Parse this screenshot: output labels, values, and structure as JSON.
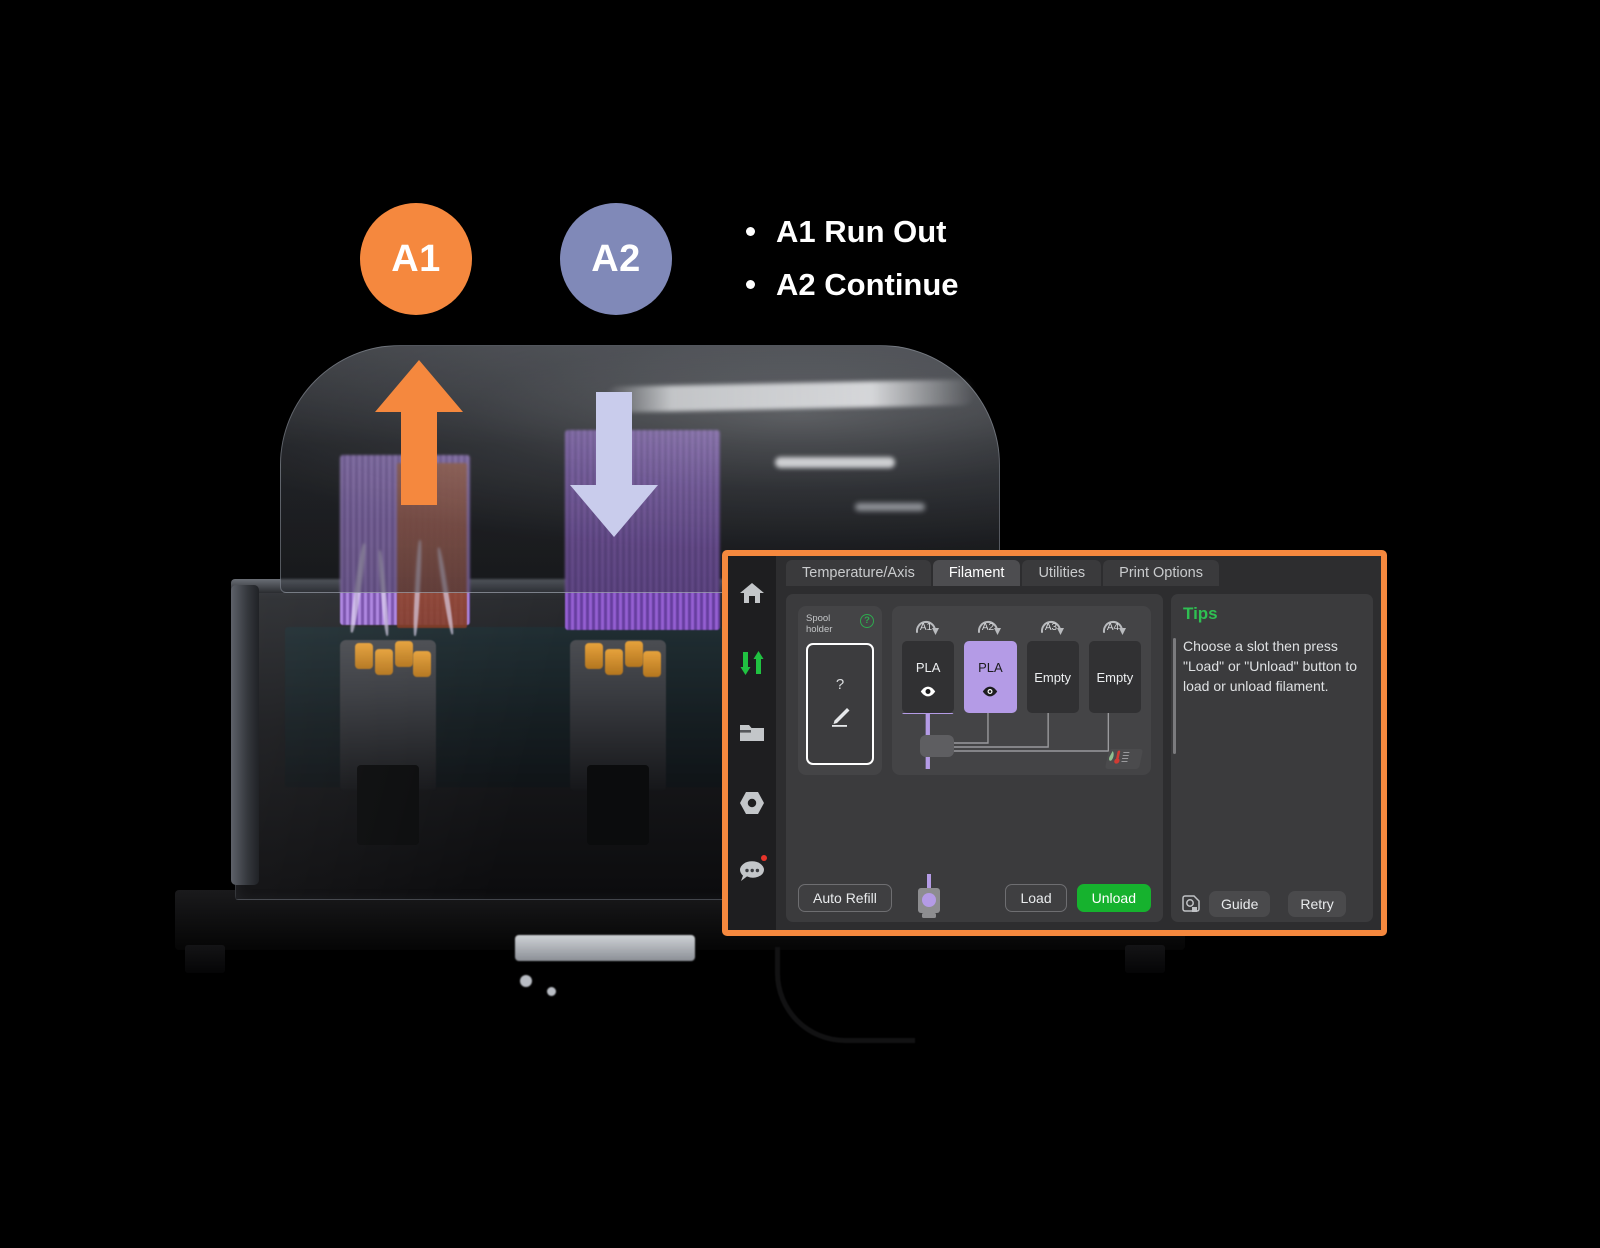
{
  "annotation": {
    "badges": [
      {
        "label": "A1",
        "color": "#F5883E"
      },
      {
        "label": "A2",
        "color": "#8089B8"
      }
    ],
    "bullets": [
      "A1 Run Out",
      "A2 Continue"
    ],
    "arrows": [
      {
        "name": "a1-up-arrow",
        "direction": "up",
        "color": "#F5883E"
      },
      {
        "name": "a2-down-arrow",
        "direction": "down",
        "color": "#C9CCEC"
      }
    ]
  },
  "ui": {
    "accent_border": "#F5883E",
    "sidebar": {
      "items": [
        {
          "icon": "home-icon",
          "name": "home"
        },
        {
          "icon": "sliders-icon",
          "name": "control",
          "active": true,
          "color": "#2fbf52"
        },
        {
          "icon": "folder-icon",
          "name": "files"
        },
        {
          "icon": "hex-nut-icon",
          "name": "calibration"
        },
        {
          "icon": "chat-bubble-icon",
          "name": "messages",
          "badge": true
        }
      ]
    },
    "tabs": [
      {
        "label": "Temperature/Axis",
        "active": false
      },
      {
        "label": "Filament",
        "active": true
      },
      {
        "label": "Utilities",
        "active": false
      },
      {
        "label": "Print Options",
        "active": false
      }
    ],
    "spool_holder": {
      "label_line1": "Spool",
      "label_line2": "holder",
      "help_glyph": "?",
      "card_value": "?",
      "edit_icon": "pencil-icon"
    },
    "slots": [
      {
        "id": "A1",
        "material": "PLA",
        "state": "loaded",
        "selected": false,
        "color": "#B49BE6",
        "eye_icon": "eye-icon"
      },
      {
        "id": "A2",
        "material": "PLA",
        "state": "loaded",
        "selected": true,
        "color": "#B49BE6",
        "eye_icon": "eye-icon"
      },
      {
        "id": "A3",
        "material": "Empty",
        "state": "empty",
        "selected": false,
        "eye_icon": null
      },
      {
        "id": "A4",
        "material": "Empty",
        "state": "empty",
        "selected": false,
        "eye_icon": null
      }
    ],
    "humidity_icon": "thermometer-humidity-icon",
    "buttons": {
      "auto_refill": "Auto Refill",
      "load": "Load",
      "unload": "Unload",
      "unload_color": "#16b22e"
    },
    "tips": {
      "title": "Tips",
      "body": "Choose a slot then press \"Load\" or \"Unload\" button to load or unload filament.",
      "title_color": "#2fbf52"
    },
    "tips_footer": {
      "camera_icon": "camera-icon",
      "guide": "Guide",
      "retry": "Retry"
    }
  }
}
